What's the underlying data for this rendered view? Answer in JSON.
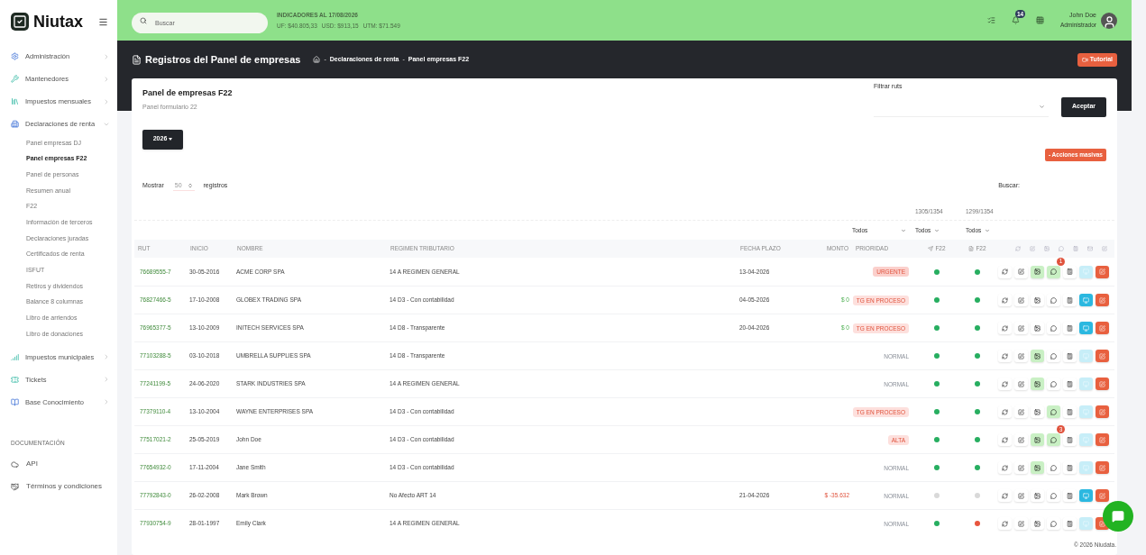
{
  "sidebar": {
    "logo": "Niutax",
    "items": [
      {
        "label": "Administración",
        "expanded": false
      },
      {
        "label": "Mantenedores",
        "expanded": false
      },
      {
        "label": "Impuestos mensuales",
        "expanded": false
      },
      {
        "label": "Declaraciones de renta",
        "expanded": true,
        "children": [
          {
            "label": "Panel empresas DJ",
            "selected": false
          },
          {
            "label": "Panel empresas F22",
            "selected": true
          },
          {
            "label": "Panel de personas",
            "selected": false
          },
          {
            "label": "Resumen anual",
            "selected": false
          },
          {
            "label": "F22",
            "selected": false
          },
          {
            "label": "Información de terceros",
            "selected": false
          },
          {
            "label": "Declaraciones juradas",
            "selected": false
          },
          {
            "label": "Certificados de renta",
            "selected": false
          },
          {
            "label": "ISFUT",
            "selected": false
          },
          {
            "label": "Retiros y dividendos",
            "selected": false
          },
          {
            "label": "Balance 8 columnas",
            "selected": false
          },
          {
            "label": "Libro de arriendos",
            "selected": false
          },
          {
            "label": "Libro de donaciones",
            "selected": false
          }
        ]
      },
      {
        "label": "Impuestos municipales",
        "expanded": false
      },
      {
        "label": "Tickets",
        "expanded": false
      },
      {
        "label": "Base Conocimiento",
        "expanded": false
      }
    ],
    "section": "DOCUMENTACIÓN",
    "doc_items": [
      "API",
      "Términos y condiciones"
    ]
  },
  "topbar": {
    "search": {
      "placeholder": "Buscar"
    },
    "indicators_title": "INDICADORES AL 17/08/2026",
    "indicators": [
      "UF: $40.805,33",
      "USD: $913,15",
      "UTM: $71.549"
    ],
    "notifications": "14",
    "user": {
      "name": "John Doe",
      "role": "Administrador"
    }
  },
  "header": {
    "title": "Registros del Panel de empresas",
    "breadcrumb": [
      {
        "separator": "-",
        "label": "Declaraciones de renta"
      },
      {
        "separator": "-",
        "label": "Panel empresas F22"
      }
    ],
    "tutorial": "Tutorial"
  },
  "card": {
    "title": "Panel de empresas F22",
    "subtitle": "Panel formulario 22",
    "filter_label": "Filtrar ruts",
    "accept": "Aceptar",
    "year": "2026",
    "bulk_actions": "- Acciones masivas",
    "show_label": "Mostrar",
    "page_size": "50",
    "records_label": "registros",
    "search_label": "Buscar:"
  },
  "table": {
    "counts": [
      "1305/1354",
      "1299/1354"
    ],
    "filters": [
      "Todos",
      "Todos",
      "Todos"
    ],
    "columns": [
      "RUT",
      "INICIO",
      "NOMBRE",
      "REGIMEN TRIBUTARIO",
      "FECHA PLAZO",
      "MONTO",
      "PRIORIDAD",
      "F22",
      "F22"
    ],
    "rows": [
      {
        "rut": "76689555-7",
        "inicio": "30-05-2016",
        "nombre": "ACME CORP SPA",
        "regimen": "14 A REGIMEN GENERAL",
        "fecha_plazo": "13-04-2026",
        "priority": {
          "text": "URGENTE",
          "kind": "urgent"
        },
        "dots": [
          {
            "color": "#27ae60"
          },
          {
            "color": "#27ae60"
          }
        ],
        "image_on": true,
        "chat_on": true,
        "chat_badge": "1",
        "view_on": false
      },
      {
        "rut": "76827466-5",
        "inicio": "17-10-2008",
        "nombre": "GLOBEX TRADING SPA",
        "regimen": "14 D3 - Con contabilidad",
        "fecha_plazo": "04-05-2026",
        "monto": {
          "text": "$ 0",
          "kind": "positive"
        },
        "priority": {
          "text": "TG EN PROCESO",
          "kind": "process"
        },
        "dots": [
          {
            "color": "#27ae60"
          },
          {
            "color": "#27ae60"
          }
        ],
        "image_on": false,
        "chat_on": false,
        "view_on": true
      },
      {
        "rut": "76965377-5",
        "inicio": "13-10-2009",
        "nombre": "INITECH SERVICES SPA",
        "regimen": "14 D8 - Transparente",
        "fecha_plazo": "20-04-2026",
        "monto": {
          "text": "$ 0",
          "kind": "positive"
        },
        "priority": {
          "text": "TG EN PROCESO",
          "kind": "process"
        },
        "dots": [
          {
            "color": "#27ae60"
          },
          {
            "color": "#27ae60"
          }
        ],
        "image_on": false,
        "chat_on": false,
        "view_on": true
      },
      {
        "rut": "77103288-5",
        "inicio": "03-10-2018",
        "nombre": "UMBRELLA SUPPLIES SPA",
        "regimen": "14 D8 - Transparente",
        "priority": {
          "text": "NORMAL",
          "kind": "normal"
        },
        "dots": [
          {
            "color": "#27ae60"
          },
          {
            "color": "#27ae60"
          }
        ],
        "image_on": true,
        "chat_on": false,
        "view_on": false
      },
      {
        "rut": "77241199-5",
        "inicio": "24-06-2020",
        "nombre": "STARK INDUSTRIES SPA",
        "regimen": "14 A REGIMEN GENERAL",
        "priority": {
          "text": "NORMAL",
          "kind": "normal"
        },
        "dots": [
          {
            "color": "#27ae60"
          },
          {
            "color": "#27ae60"
          }
        ],
        "image_on": true,
        "chat_on": false,
        "view_on": false
      },
      {
        "rut": "77379110-4",
        "inicio": "13-10-2004",
        "nombre": "WAYNE ENTERPRISES SPA",
        "regimen": "14 D3 - Con contabilidad",
        "priority": {
          "text": "TG EN PROCESO",
          "kind": "process"
        },
        "dots": [
          {
            "color": "#27ae60"
          },
          {
            "color": "#27ae60"
          }
        ],
        "image_on": false,
        "chat_on": true,
        "view_on": false
      },
      {
        "rut": "77517021-2",
        "inicio": "25-05-2019",
        "nombre": "John Doe",
        "regimen": "14 D3 - Con contabilidad",
        "priority": {
          "text": "ALTA",
          "kind": "high"
        },
        "dots": [
          {
            "color": "#27ae60"
          },
          {
            "color": "#27ae60"
          }
        ],
        "image_on": true,
        "chat_on": true,
        "chat_badge": "3",
        "view_on": false
      },
      {
        "rut": "77654932-0",
        "inicio": "17-11-2004",
        "nombre": "Jane Smith",
        "regimen": "14 D3 - Con contabilidad",
        "priority": {
          "text": "NORMAL",
          "kind": "normal"
        },
        "dots": [
          {
            "color": "#27ae60"
          },
          {
            "color": "#27ae60"
          }
        ],
        "image_on": true,
        "chat_on": false,
        "view_on": false
      },
      {
        "rut": "77792843-0",
        "inicio": "26-02-2008",
        "nombre": "Mark Brown",
        "regimen": "No Afecto ART 14",
        "fecha_plazo": "21-04-2026",
        "monto": {
          "text": "$ -35.632",
          "kind": "negative"
        },
        "priority": {
          "text": "NORMAL",
          "kind": "normal"
        },
        "dots": [
          {
            "color": "#d9d9d9"
          },
          {
            "color": "#d9d9d9"
          }
        ],
        "image_on": false,
        "chat_on": false,
        "view_on": true
      },
      {
        "rut": "77930754-9",
        "inicio": "28-01-1997",
        "nombre": "Emily Clark",
        "regimen": "14 A REGIMEN GENERAL",
        "priority": {
          "text": "NORMAL",
          "kind": "normal"
        },
        "dots": [
          {
            "color": "#27ae60"
          },
          {
            "color": "#e8553e"
          }
        ],
        "image_on": false,
        "chat_on": false,
        "view_on": false
      }
    ]
  },
  "footer": "© 2026  Niudata."
}
